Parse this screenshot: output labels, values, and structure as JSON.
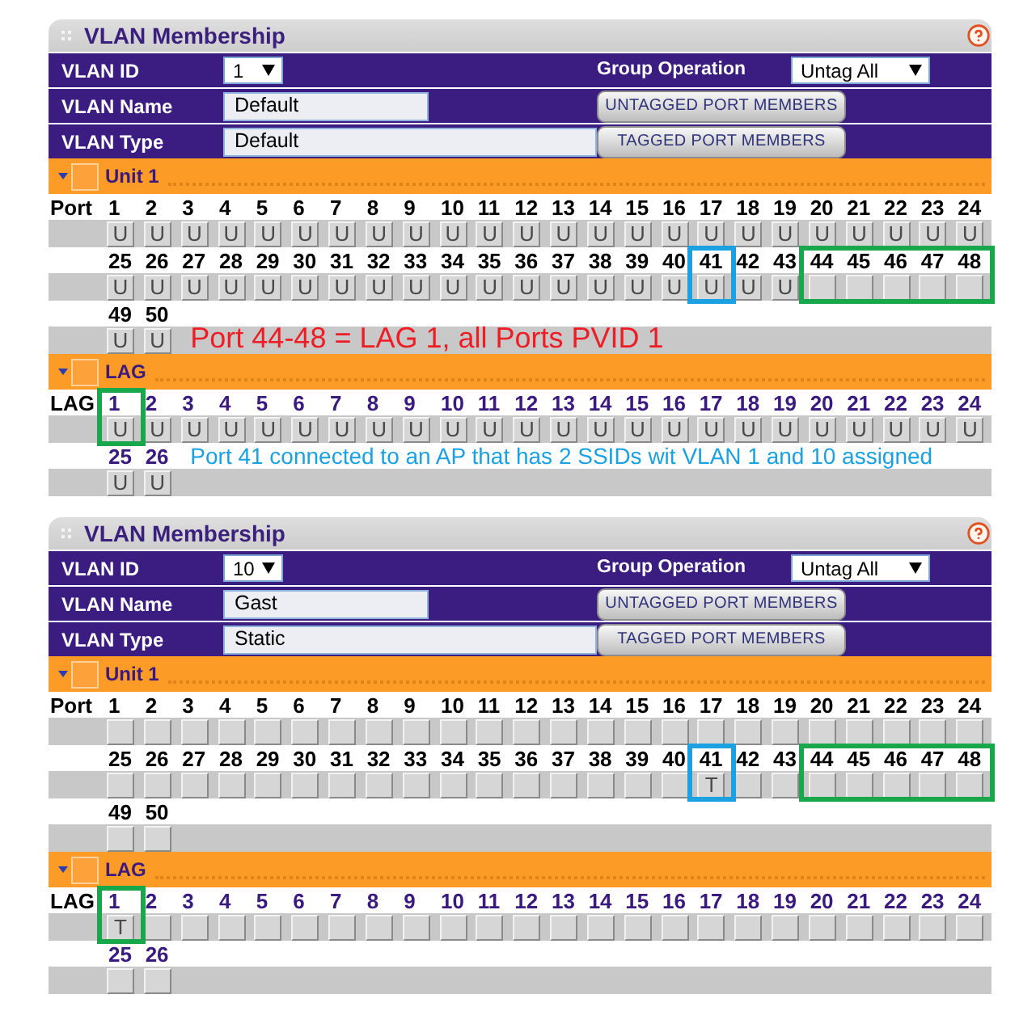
{
  "panels": [
    {
      "title": "VLAN Membership",
      "form": [
        {
          "label": "VLAN ID",
          "field": {
            "kind": "select",
            "value": "1"
          },
          "right": {
            "kind": "select",
            "label": "Group Operation",
            "value": "Untag All"
          }
        },
        {
          "label": "VLAN Name",
          "field": {
            "kind": "text",
            "value": "Default"
          },
          "right": {
            "kind": "button",
            "label": "UNTAGGED PORT MEMBERS"
          }
        },
        {
          "label": "VLAN Type",
          "field": {
            "kind": "text",
            "value": "Default"
          },
          "right": {
            "kind": "button",
            "label": "TAGGED PORT MEMBERS"
          }
        }
      ],
      "sections": [
        {
          "kind": "unit",
          "title": "Unit 1",
          "checked": false,
          "row_label": "Port",
          "rows": [
            {
              "ports": [
                {
                  "label": "1",
                  "value": "U"
                },
                {
                  "label": "2",
                  "value": "U"
                },
                {
                  "label": "3",
                  "value": "U"
                },
                {
                  "label": "4",
                  "value": "U"
                },
                {
                  "label": "5",
                  "value": "U"
                },
                {
                  "label": "6",
                  "value": "U"
                },
                {
                  "label": "7",
                  "value": "U"
                },
                {
                  "label": "8",
                  "value": "U"
                },
                {
                  "label": "9",
                  "value": "U"
                },
                {
                  "label": "10",
                  "value": "U"
                },
                {
                  "label": "11",
                  "value": "U"
                },
                {
                  "label": "12",
                  "value": "U"
                },
                {
                  "label": "13",
                  "value": "U"
                },
                {
                  "label": "14",
                  "value": "U"
                },
                {
                  "label": "15",
                  "value": "U"
                },
                {
                  "label": "16",
                  "value": "U"
                },
                {
                  "label": "17",
                  "value": "U"
                },
                {
                  "label": "18",
                  "value": "U"
                },
                {
                  "label": "19",
                  "value": "U"
                },
                {
                  "label": "20",
                  "value": "U"
                },
                {
                  "label": "21",
                  "value": "U"
                },
                {
                  "label": "22",
                  "value": "U"
                },
                {
                  "label": "23",
                  "value": "U"
                },
                {
                  "label": "24",
                  "value": "U"
                }
              ]
            },
            {
              "ports": [
                {
                  "label": "25",
                  "value": "U"
                },
                {
                  "label": "26",
                  "value": "U"
                },
                {
                  "label": "27",
                  "value": "U"
                },
                {
                  "label": "28",
                  "value": "U"
                },
                {
                  "label": "29",
                  "value": "U"
                },
                {
                  "label": "30",
                  "value": "U"
                },
                {
                  "label": "31",
                  "value": "U"
                },
                {
                  "label": "32",
                  "value": "U"
                },
                {
                  "label": "33",
                  "value": "U"
                },
                {
                  "label": "34",
                  "value": "U"
                },
                {
                  "label": "35",
                  "value": "U"
                },
                {
                  "label": "36",
                  "value": "U"
                },
                {
                  "label": "37",
                  "value": "U"
                },
                {
                  "label": "38",
                  "value": "U"
                },
                {
                  "label": "39",
                  "value": "U"
                },
                {
                  "label": "40",
                  "value": "U"
                },
                {
                  "label": "41",
                  "value": "U",
                  "color": "#1ba1e2"
                },
                {
                  "label": "42",
                  "value": "U"
                },
                {
                  "label": "43",
                  "value": "U"
                },
                {
                  "label": "44",
                  "color": "#18a84b"
                },
                {
                  "label": "45",
                  "color": "#18a84b"
                },
                {
                  "label": "46",
                  "color": "#18a84b"
                },
                {
                  "label": "47",
                  "color": "#18a84b"
                },
                {
                  "label": "48",
                  "color": "#18a84b"
                }
              ]
            },
            {
              "ports": [
                {
                  "label": "49",
                  "value": "U"
                },
                {
                  "label": "50",
                  "value": "U"
                }
              ]
            }
          ],
          "note": {
            "text": "Port 44-48 = LAG 1, all Ports PVID 1",
            "color": "#ee1c24"
          }
        },
        {
          "kind": "lag",
          "title": "LAG",
          "checked": false,
          "row_label": "LAG",
          "rows": [
            {
              "ports": [
                {
                  "label": "1",
                  "value": "U",
                  "color": "#18a84b"
                },
                {
                  "label": "2",
                  "value": "U"
                },
                {
                  "label": "3",
                  "value": "U"
                },
                {
                  "label": "4",
                  "value": "U"
                },
                {
                  "label": "5",
                  "value": "U"
                },
                {
                  "label": "6",
                  "value": "U"
                },
                {
                  "label": "7",
                  "value": "U"
                },
                {
                  "label": "8",
                  "value": "U"
                },
                {
                  "label": "9",
                  "value": "U"
                },
                {
                  "label": "10",
                  "value": "U"
                },
                {
                  "label": "11",
                  "value": "U"
                },
                {
                  "label": "12",
                  "value": "U"
                },
                {
                  "label": "13",
                  "value": "U"
                },
                {
                  "label": "14",
                  "value": "U"
                },
                {
                  "label": "15",
                  "value": "U"
                },
                {
                  "label": "16",
                  "value": "U"
                },
                {
                  "label": "17",
                  "value": "U"
                },
                {
                  "label": "18",
                  "value": "U"
                },
                {
                  "label": "19",
                  "value": "U"
                },
                {
                  "label": "20",
                  "value": "U"
                },
                {
                  "label": "21",
                  "value": "U"
                },
                {
                  "label": "22",
                  "value": "U"
                },
                {
                  "label": "23",
                  "value": "U"
                },
                {
                  "label": "24",
                  "value": "U"
                }
              ]
            },
            {
              "ports": [
                {
                  "label": "25",
                  "value": "U"
                },
                {
                  "label": "26",
                  "value": "U"
                }
              ]
            }
          ],
          "note": {
            "text": "Port 41 connected to an AP that has 2 SSIDs wit VLAN 1 and 10 assigned",
            "color": "#1ba1e2"
          }
        }
      ]
    },
    {
      "title": "VLAN Membership",
      "form": [
        {
          "label": "VLAN ID",
          "field": {
            "kind": "select",
            "value": "10"
          },
          "right": {
            "kind": "select",
            "label": "Group Operation",
            "value": "Untag All"
          }
        },
        {
          "label": "VLAN Name",
          "field": {
            "kind": "text",
            "value": "Gast"
          },
          "right": {
            "kind": "button",
            "label": "UNTAGGED PORT MEMBERS"
          }
        },
        {
          "label": "VLAN Type",
          "field": {
            "kind": "text",
            "value": "Static"
          },
          "right": {
            "kind": "button",
            "label": "TAGGED PORT MEMBERS"
          }
        }
      ],
      "sections": [
        {
          "kind": "unit",
          "title": "Unit 1",
          "checked": false,
          "row_label": "Port",
          "rows": [
            {
              "ports": [
                {
                  "label": "1"
                },
                {
                  "label": "2"
                },
                {
                  "label": "3"
                },
                {
                  "label": "4"
                },
                {
                  "label": "5"
                },
                {
                  "label": "6"
                },
                {
                  "label": "7"
                },
                {
                  "label": "8"
                },
                {
                  "label": "9"
                },
                {
                  "label": "10"
                },
                {
                  "label": "11"
                },
                {
                  "label": "12"
                },
                {
                  "label": "13"
                },
                {
                  "label": "14"
                },
                {
                  "label": "15"
                },
                {
                  "label": "16"
                },
                {
                  "label": "17"
                },
                {
                  "label": "18"
                },
                {
                  "label": "19"
                },
                {
                  "label": "20"
                },
                {
                  "label": "21"
                },
                {
                  "label": "22"
                },
                {
                  "label": "23"
                },
                {
                  "label": "24"
                }
              ]
            },
            {
              "ports": [
                {
                  "label": "25"
                },
                {
                  "label": "26"
                },
                {
                  "label": "27"
                },
                {
                  "label": "28"
                },
                {
                  "label": "29"
                },
                {
                  "label": "30"
                },
                {
                  "label": "31"
                },
                {
                  "label": "32"
                },
                {
                  "label": "33"
                },
                {
                  "label": "34"
                },
                {
                  "label": "35"
                },
                {
                  "label": "36"
                },
                {
                  "label": "37"
                },
                {
                  "label": "38"
                },
                {
                  "label": "39"
                },
                {
                  "label": "40"
                },
                {
                  "label": "41",
                  "value": "T",
                  "color": "#1ba1e2"
                },
                {
                  "label": "42"
                },
                {
                  "label": "43"
                },
                {
                  "label": "44",
                  "color": "#18a84b"
                },
                {
                  "label": "45",
                  "color": "#18a84b"
                },
                {
                  "label": "46",
                  "color": "#18a84b"
                },
                {
                  "label": "47",
                  "color": "#18a84b"
                },
                {
                  "label": "48",
                  "color": "#18a84b"
                }
              ]
            },
            {
              "ports": [
                {
                  "label": "49"
                },
                {
                  "label": "50"
                }
              ]
            }
          ]
        },
        {
          "kind": "lag",
          "title": "LAG",
          "checked": false,
          "row_label": "LAG",
          "rows": [
            {
              "ports": [
                {
                  "label": "1",
                  "value": "T",
                  "color": "#18a84b"
                },
                {
                  "label": "2"
                },
                {
                  "label": "3"
                },
                {
                  "label": "4"
                },
                {
                  "label": "5"
                },
                {
                  "label": "6"
                },
                {
                  "label": "7"
                },
                {
                  "label": "8"
                },
                {
                  "label": "9"
                },
                {
                  "label": "10"
                },
                {
                  "label": "11"
                },
                {
                  "label": "12"
                },
                {
                  "label": "13"
                },
                {
                  "label": "14"
                },
                {
                  "label": "15"
                },
                {
                  "label": "16"
                },
                {
                  "label": "17"
                },
                {
                  "label": "18"
                },
                {
                  "label": "19"
                },
                {
                  "label": "20"
                },
                {
                  "label": "21"
                },
                {
                  "label": "22"
                },
                {
                  "label": "23"
                },
                {
                  "label": "24"
                }
              ]
            },
            {
              "ports": [
                {
                  "label": "25"
                },
                {
                  "label": "26"
                }
              ]
            }
          ]
        }
      ]
    }
  ]
}
